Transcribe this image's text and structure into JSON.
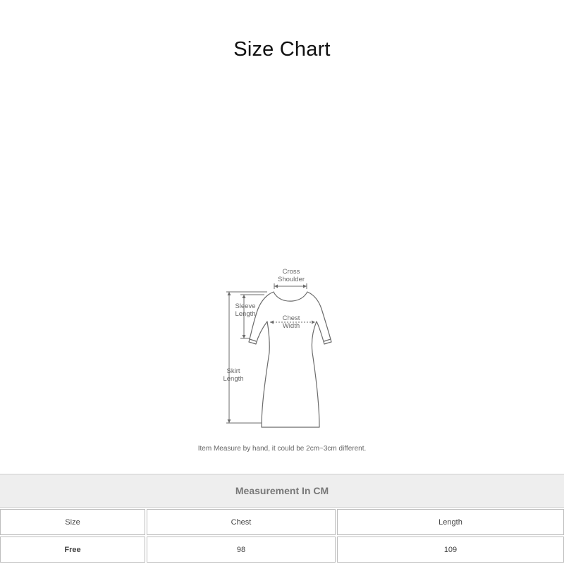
{
  "title": "Size Chart",
  "diagram": {
    "labels": {
      "cross_shoulder": "Cross\nShoulder",
      "sleeve_length": "Sleeve\nLength",
      "chest_width": "Chest\nWidth",
      "skirt_length": "Skirt\nLength"
    },
    "note": "Item Measure by hand, it could be 2cm~3cm different."
  },
  "table": {
    "header": "Measurement In CM",
    "columns": [
      "Size",
      "Chest",
      "Length"
    ],
    "rows": [
      [
        "Free",
        "98",
        "109"
      ]
    ]
  },
  "colors": {
    "header_bg": "#eeeeee",
    "border": "#bdbdbd",
    "diagram_line": "#6b6b6b"
  }
}
